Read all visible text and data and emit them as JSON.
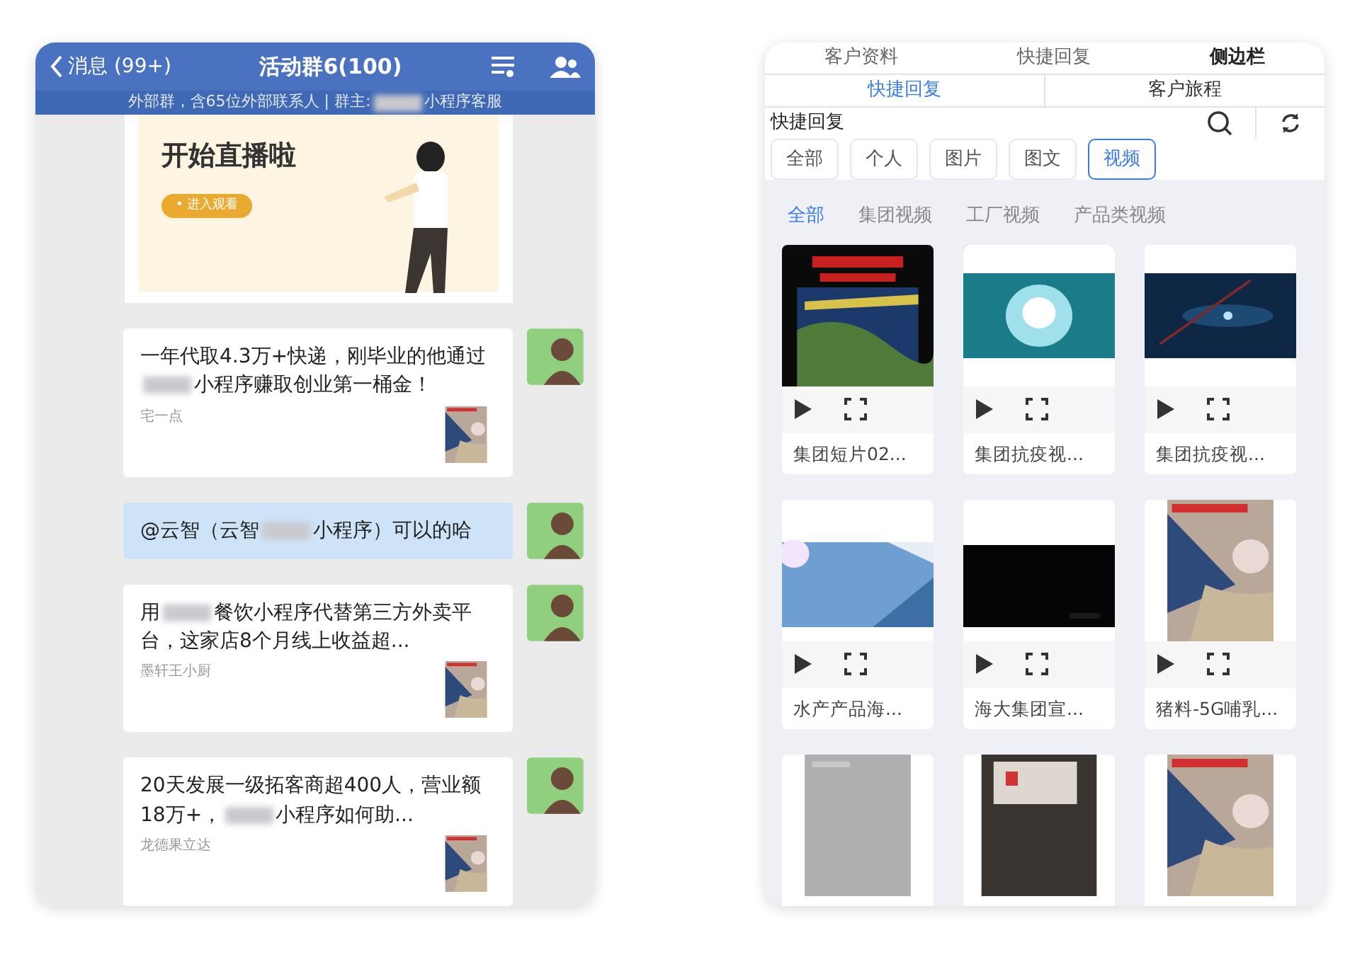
{
  "chat_header": {
    "back_label": "消息 (99+)",
    "title": "活动群6(100)",
    "subtitle_parts": [
      "外部群，含65位外部联系人 | 群主:",
      "小程序客服"
    ]
  },
  "live_card": {
    "title": "开始直播啦",
    "button": "• 进入观看"
  },
  "messages": [
    {
      "kind": "link",
      "text_parts": [
        "一年代取4.3万+快递，刚毕业的他通过",
        "小程序赚取创业第一桶金！"
      ],
      "source": "宅一点"
    },
    {
      "kind": "text",
      "text_parts": [
        "@云智（云智",
        "小程序）可以的哈"
      ]
    },
    {
      "kind": "link",
      "text_parts": [
        "用",
        "餐饮小程序代替第三方外卖平台，这家店8个月线上收益超..."
      ],
      "source": "墨轩王小厨"
    },
    {
      "kind": "link",
      "text_parts": [
        "20天发展一级拓客商超400人，营业额18万+，",
        "小程序如何助..."
      ],
      "source": "龙德果立达"
    }
  ],
  "top_tabs": [
    {
      "label": "客户资料",
      "selected": false
    },
    {
      "label": "快捷回复",
      "selected": false
    },
    {
      "label": "侧边栏",
      "selected": true
    }
  ],
  "sub_tabs": [
    {
      "label": "快捷回复",
      "selected": true
    },
    {
      "label": "客户旅程",
      "selected": false
    }
  ],
  "section_title": "快捷回复",
  "filters": [
    {
      "label": "全部",
      "selected": false
    },
    {
      "label": "个人",
      "selected": false
    },
    {
      "label": "图片",
      "selected": false
    },
    {
      "label": "图文",
      "selected": false
    },
    {
      "label": "视频",
      "selected": true
    }
  ],
  "categories": [
    {
      "label": "全部",
      "selected": true
    },
    {
      "label": "集团视频",
      "selected": false
    },
    {
      "label": "工厂视频",
      "selected": false
    },
    {
      "label": "产品类视频",
      "selected": false
    }
  ],
  "videos": [
    {
      "kind": "map",
      "title": "集团短片02..."
    },
    {
      "kind": "glow",
      "title": "集团抗疫视..."
    },
    {
      "kind": "space",
      "title": "集团抗疫视..."
    },
    {
      "kind": "sky",
      "title": "水产产品海..."
    },
    {
      "kind": "dark",
      "title": "海大集团宣..."
    },
    {
      "kind": "farm",
      "title": "猪料-5G哺乳..."
    },
    {
      "kind": "grey"
    },
    {
      "kind": "paper"
    },
    {
      "kind": "farm"
    }
  ]
}
